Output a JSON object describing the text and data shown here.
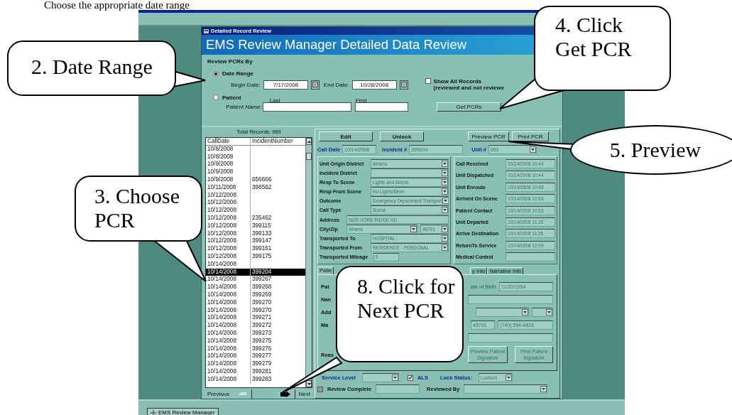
{
  "caption": "Choose the appropriate date range",
  "window": {
    "title": "Detailed Record Review",
    "heading": "EMS Review Manager Detailed Data Review"
  },
  "filter": {
    "section_label": "Review PCRs By",
    "modes": [
      {
        "label": "Date Range",
        "selected": true
      },
      {
        "label": "Patient",
        "selected": false
      }
    ],
    "begin_date": {
      "label": "Begin Date:",
      "value": "7/17/2008"
    },
    "end_date": {
      "label": "End Date:",
      "value": "10/28/2008"
    },
    "show_all": {
      "label": "Show All Records",
      "note": "(reviewed and not reviewe",
      "checked": false
    },
    "patient_name": {
      "label": "Patient Name:",
      "last_label": "Last",
      "first_label": "First"
    },
    "get_button": "Get PCRs"
  },
  "record_list": {
    "total": "Total Records: 969",
    "columns": [
      "CallDate",
      "IncidentNumber"
    ],
    "rows": [
      {
        "call_date": "10/8/2008",
        "incident": "",
        "selected": false
      },
      {
        "call_date": "10/8/2008",
        "incident": "",
        "selected": false
      },
      {
        "call_date": "10/9/2008",
        "incident": "",
        "selected": false
      },
      {
        "call_date": "10/9/2008",
        "incident": "",
        "selected": false
      },
      {
        "call_date": "10/9/2008",
        "incident": "656666",
        "selected": false
      },
      {
        "call_date": "10/11/2008",
        "incident": "398562",
        "selected": false
      },
      {
        "call_date": "10/12/2008",
        "incident": "",
        "selected": false
      },
      {
        "call_date": "10/12/2008",
        "incident": "",
        "selected": false
      },
      {
        "call_date": "10/12/2008",
        "incident": "",
        "selected": false
      },
      {
        "call_date": "10/12/2008",
        "incident": "235462",
        "selected": false
      },
      {
        "call_date": "10/12/2008",
        "incident": "399115",
        "selected": false
      },
      {
        "call_date": "10/12/2008",
        "incident": "399133",
        "selected": false
      },
      {
        "call_date": "10/12/2008",
        "incident": "399147",
        "selected": false
      },
      {
        "call_date": "10/12/2008",
        "incident": "399161",
        "selected": false
      },
      {
        "call_date": "10/12/2008",
        "incident": "399175",
        "selected": false
      },
      {
        "call_date": "10/14/2008",
        "incident": "",
        "selected": false
      },
      {
        "call_date": "10/14/2008",
        "incident": "399204",
        "selected": true
      },
      {
        "call_date": "10/14/2008",
        "incident": "399267",
        "selected": false
      },
      {
        "call_date": "10/14/2008",
        "incident": "399268",
        "selected": false
      },
      {
        "call_date": "10/14/2008",
        "incident": "399269",
        "selected": false
      },
      {
        "call_date": "10/14/2008",
        "incident": "399270",
        "selected": false
      },
      {
        "call_date": "10/14/2008",
        "incident": "399270",
        "selected": false
      },
      {
        "call_date": "10/14/2008",
        "incident": "399271",
        "selected": false
      },
      {
        "call_date": "10/14/2008",
        "incident": "399272",
        "selected": false
      },
      {
        "call_date": "10/14/2008",
        "incident": "399273",
        "selected": false
      },
      {
        "call_date": "10/14/2008",
        "incident": "399275",
        "selected": false
      },
      {
        "call_date": "10/14/2008",
        "incident": "399276",
        "selected": false
      },
      {
        "call_date": "10/14/2008",
        "incident": "399277",
        "selected": false
      },
      {
        "call_date": "10/14/2008",
        "incident": "399279",
        "selected": false
      },
      {
        "call_date": "10/14/2008",
        "incident": "399281",
        "selected": false
      },
      {
        "call_date": "10/14/2008",
        "incident": "399283",
        "selected": false
      }
    ],
    "previous": "Previous",
    "next": "Next"
  },
  "detail": {
    "buttons": [
      "Edit",
      "Unlock",
      "Preview PCR",
      "Print PCR"
    ],
    "call_date": {
      "label": "Call Date",
      "value": "10/14/2008"
    },
    "incident": {
      "label": "Incident #",
      "value": "399204"
    },
    "unit": {
      "label": "Unit #",
      "value": "001"
    },
    "left_fields": [
      {
        "kind": "select",
        "label": "Unit Origin District",
        "value": "Athens"
      },
      {
        "kind": "select",
        "label": "Incident District"
      },
      {
        "kind": "select",
        "label": "Resp To Scene",
        "value": "Lights and Sirens"
      },
      {
        "kind": "select",
        "label": "Resp From Scene",
        "value": "No Lights/Siren"
      },
      {
        "kind": "select",
        "label": "Outcome",
        "value": "Emergency Department Transport"
      },
      {
        "kind": "select",
        "label": "Call Type",
        "value": "Scene"
      },
      {
        "kind": "text",
        "label": "Address",
        "value": "5620 VORE RIDGE RD"
      },
      {
        "kind": "city_zip",
        "label": "City/Zip",
        "value": "Athens",
        "zip": "45701"
      },
      {
        "kind": "select",
        "label": "Transported To",
        "value": "HOSPITAL"
      },
      {
        "kind": "select",
        "label": "Transported From",
        "value": "RESIDENCE - PERSONAL"
      },
      {
        "kind": "short",
        "label": "Transported Mileage",
        "value": "5"
      }
    ],
    "right_fields": [
      {
        "label": "Call Received",
        "value": "10/14/2008 10:44"
      },
      {
        "label": "Unit Dispatched",
        "value": "10/14/2008 10:44"
      },
      {
        "label": "Unit Enroute",
        "value": "10/14/2008 10:45"
      },
      {
        "label": "Arrived On Scene",
        "value": "10/14/2008 10:53"
      },
      {
        "label": "Patient Contact",
        "value": "10/14/2008 10:53"
      },
      {
        "label": "Unit Departed",
        "value": "10/14/2008 11:15"
      },
      {
        "label": "Arrive Destination",
        "value": "10/14/2008 11:26"
      },
      {
        "label": "ReturnTo Service",
        "value": "10/14/2008 12:09"
      },
      {
        "label": "Medical Control"
      }
    ],
    "tabs": [
      {
        "label": "Patie",
        "selected": true
      },
      {
        "label": "y Info",
        "selected": false
      },
      {
        "label": "Narrative Info",
        "selected": false
      }
    ],
    "patient_tab": {
      "row_labels": [
        "Pat",
        "Nan",
        "Add",
        "Ma",
        "Reas"
      ],
      "birth_label": "ate of Birth",
      "birth_value": "11/20/1954",
      "zip": "45701",
      "phone": "(740) 594-4833",
      "buttons": [
        "Preview Patient Signature",
        "Print Patient Signature"
      ]
    },
    "service_level": {
      "label": "Service Level"
    },
    "als": {
      "label": "ALS",
      "checked": true
    },
    "lock_status": {
      "label": "Lock Status:",
      "value": "Locked"
    },
    "review_complete": {
      "label": "Review Complete",
      "checked": false
    },
    "reviewed_by": {
      "label": "Reviewed By"
    }
  },
  "taskbar": {
    "button": "EMS Review Manager"
  },
  "callouts": [
    {
      "text": "2. Date Range",
      "kind": "rounded"
    },
    {
      "text": "3. Choose PCR",
      "kind": "rounded"
    },
    {
      "text": "4. Click Get PCR",
      "kind": "rounded"
    },
    {
      "text": "5. Preview",
      "kind": "ellipse"
    },
    {
      "text": "8. Click for Next PCR",
      "kind": "rounded"
    }
  ]
}
